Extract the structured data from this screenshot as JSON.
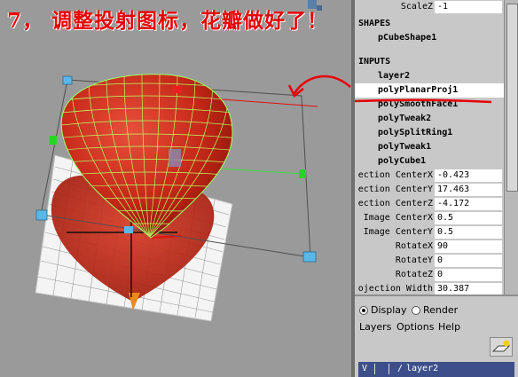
{
  "caption": "7， 调整投射图标，花瓣做好了！",
  "channel_box": {
    "top_attr": {
      "label": "ScaleZ",
      "value": "-1"
    },
    "shapes_header": "SHAPES",
    "shape_name": "pCubeShape1",
    "inputs_header": "INPUTS",
    "input_nodes": [
      {
        "label": "layer2",
        "selected": false
      },
      {
        "label": "polyPlanarProj1",
        "selected": true
      },
      {
        "label": "polySmoothFace1",
        "selected": false
      },
      {
        "label": "polyTweak2",
        "selected": false
      },
      {
        "label": "polySplitRing1",
        "selected": false
      },
      {
        "label": "polyTweak1",
        "selected": false
      },
      {
        "label": "polyCube1",
        "selected": false
      }
    ],
    "attributes": [
      {
        "label": "ection CenterX",
        "value": "-0.423"
      },
      {
        "label": "ection CenterY",
        "value": "17.463"
      },
      {
        "label": "ection CenterZ",
        "value": "-4.172"
      },
      {
        "label": "Image CenterX",
        "value": "0.5"
      },
      {
        "label": "Image CenterY",
        "value": "0.5"
      },
      {
        "label": "RotateX",
        "value": "90"
      },
      {
        "label": "RotateY",
        "value": "0"
      },
      {
        "label": "RotateZ",
        "value": "0"
      },
      {
        "label": "ojection Width",
        "value": "30.387"
      }
    ]
  },
  "layer_editor": {
    "display_label": "Display",
    "render_label": "Render",
    "display_selected": true,
    "menu": [
      "Layers",
      "Options",
      "Help"
    ],
    "layer_row": {
      "visibility": "V",
      "name": "layer2"
    }
  },
  "colors": {
    "annotation_red": "#e60000",
    "petal_red": "#c8281c",
    "wire_green": "#b8ff66",
    "selection_bg": "#ffffff",
    "layer_row_bg": "#3d4f8a"
  }
}
